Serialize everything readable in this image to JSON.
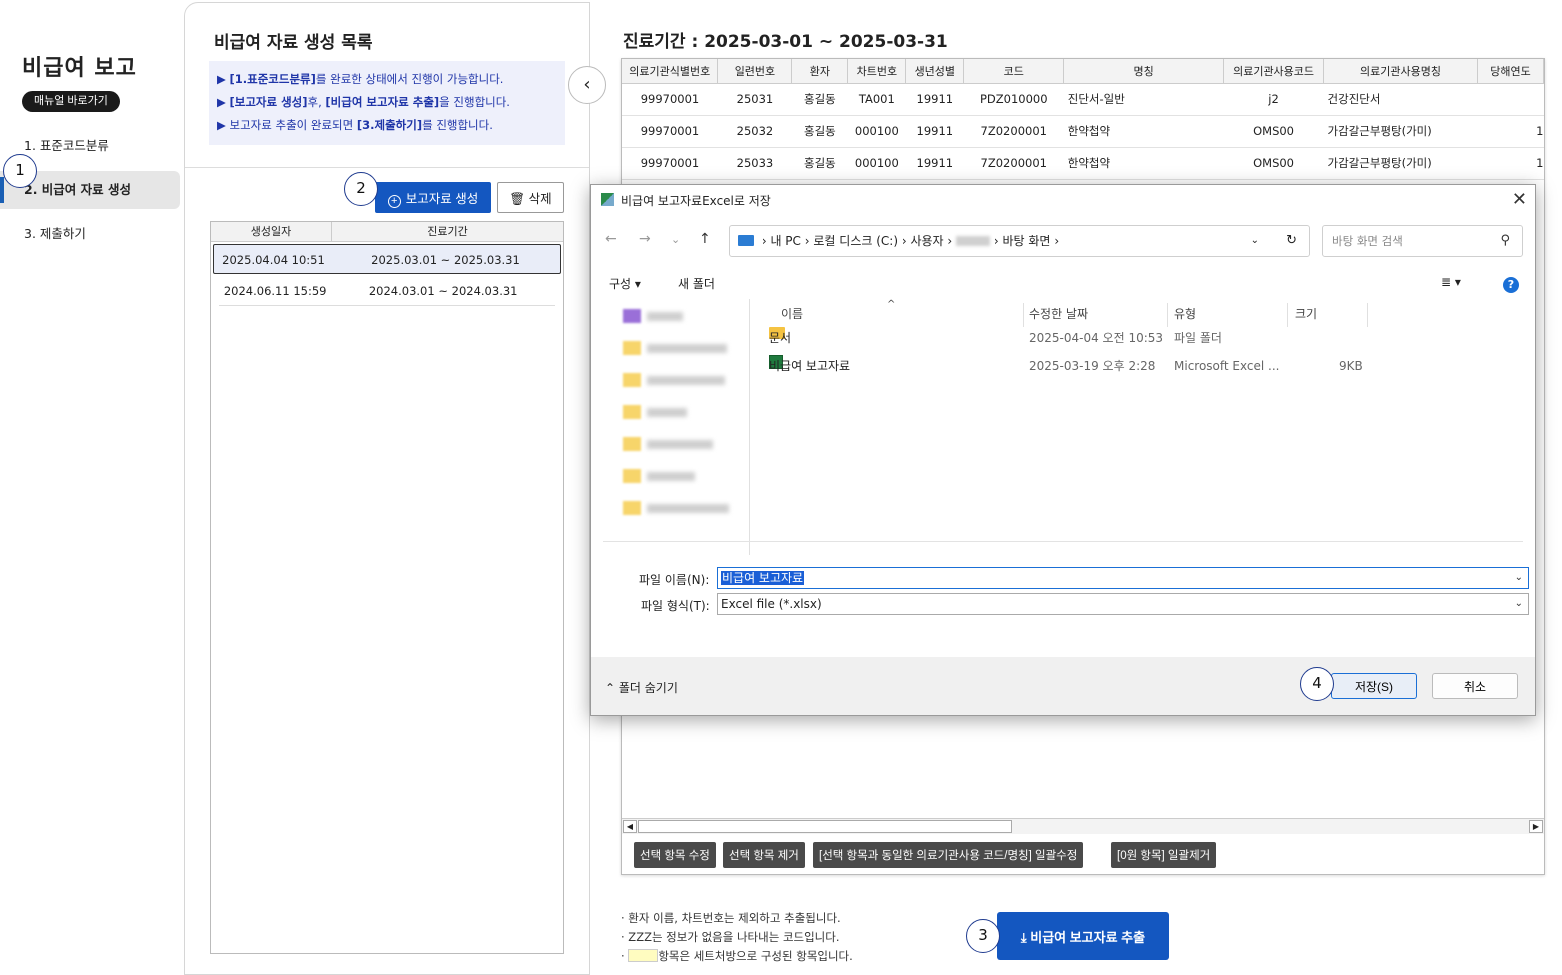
{
  "nav": {
    "title": "비급여 보고",
    "manual_label": "매뉴얼 바로가기",
    "items": [
      {
        "label": "1. 표준코드분류"
      },
      {
        "label": "2. 비급여 자료 생성"
      },
      {
        "label": "3. 제출하기"
      }
    ]
  },
  "markers": [
    "1",
    "2",
    "3",
    "4"
  ],
  "mid": {
    "title": "비급여 자료 생성 목록",
    "notice": [
      {
        "bullet": "▶",
        "strong1": "[1.표준코드분류]",
        "text1": "를 완료한 상태에서 진행이 가능합니다.",
        "strong2": "",
        "text2": ""
      },
      {
        "bullet": "▶",
        "strong1": "[보고자료 생성]",
        "text1": "후, ",
        "strong2": "[비급여 보고자료 추출]",
        "text2": "을 진행합니다."
      },
      {
        "bullet": "▶",
        "strong1": "",
        "text1": "보고자료 추출이 완료되면 ",
        "strong2": "[3.제출하기]",
        "text2": "를 진행합니다."
      }
    ],
    "generate_label": "보고자료 생성",
    "delete_label": "삭제",
    "list_headers": [
      "생성일자",
      "진료기간"
    ],
    "list_rows": [
      {
        "created": "2025.04.04  10:51",
        "period": "2025.03.01 ~ 2025.03.31"
      },
      {
        "created": "2024.06.11  15:59",
        "period": "2024.03.01 ~ 2024.03.31"
      }
    ]
  },
  "right": {
    "title": "진료기간 : 2025-03-01 ~ 2025-03-31",
    "headers": [
      "의료기관식별번호",
      "일련번호",
      "환자",
      "차트번호",
      "생년성별",
      "코드",
      "명칭",
      "의료기관사용코드",
      "의료기관사용명칭",
      "당해연도"
    ],
    "rows": [
      [
        "99970001",
        "25031",
        "홍길동",
        "TA001",
        "19911",
        "PDZ010000",
        "진단서-일반",
        "j2",
        "건강진단서",
        ""
      ],
      [
        "99970001",
        "25032",
        "홍길동",
        "000100",
        "19911",
        "7Z0200001",
        "한약첩약",
        "OMS00",
        "가감갈근부평탕(가미)",
        "1"
      ],
      [
        "99970001",
        "25033",
        "홍길동",
        "000100",
        "19911",
        "7Z0200001",
        "한약첩약",
        "OMS00",
        "가감갈근부평탕(가미)",
        "1"
      ]
    ],
    "actions": [
      "선택 항목 수정",
      "선택 항목 제거",
      "[선택 항목과 동일한 의료기관사용 코드/명칭] 일괄수정",
      "[0원 항목] 일괄제거"
    ],
    "footnotes": [
      "· 환자 이름, 차트번호는 제외하고 추출됩니다.",
      "· ZZZ는 정보가 없음을 나타내는 코드입니다.",
      "항목은 세트처방으로 구성된 항목입니다."
    ],
    "footnote_prefix": "·",
    "extract_label": "비급여 보고자료 추출"
  },
  "dialog": {
    "title": "비급여 보고자료Excel로 저장",
    "path": [
      "내 PC",
      "로컬 디스크 (C:)",
      "사용자",
      "바탕 화면"
    ],
    "search_placeholder": "바탕 화면 검색",
    "organize_label": "구성 ▾",
    "new_folder_label": "새 폴더",
    "columns": [
      "이름",
      "수정한 날짜",
      "유형",
      "크기"
    ],
    "files": [
      {
        "name": "문서",
        "modified": "2025-04-04 오전 10:53",
        "type": "파일 폴더",
        "size": "",
        "kind": "folder"
      },
      {
        "name": "비급여 보고자료",
        "modified": "2025-03-19 오후 2:28",
        "type": "Microsoft Excel ...",
        "size": "9KB",
        "kind": "excel"
      }
    ],
    "filename_label": "파일 이름(N):",
    "filename_value": "비급여 보고자료",
    "filetype_label": "파일 형식(T):",
    "filetype_value": "Excel file (*.xlsx)",
    "hide_folders_label": "폴더 숨기기",
    "save_label": "저장(S)",
    "cancel_label": "취소"
  }
}
